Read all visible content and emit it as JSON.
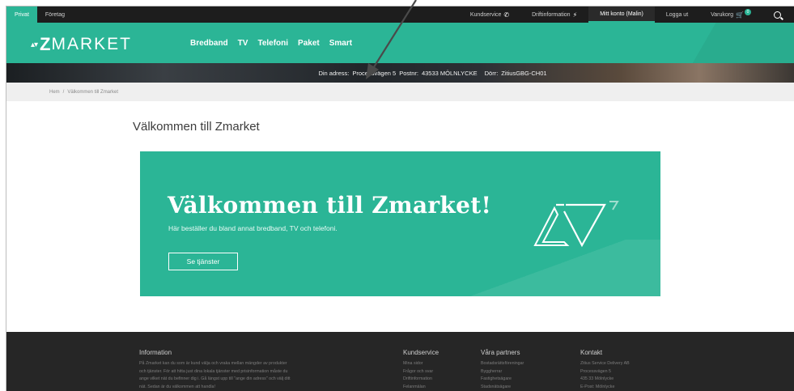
{
  "topbar": {
    "segments": [
      "Privat",
      "Företag"
    ],
    "links": [
      {
        "label": "Kundservice",
        "icon": "phone-icon"
      },
      {
        "label": "Driftinformation",
        "icon": "plug-icon"
      },
      {
        "label": "Mitt konto (Malin)",
        "icon": ""
      },
      {
        "label": "Logga ut",
        "icon": ""
      },
      {
        "label": "Varukorg",
        "icon": "cart-icon",
        "badge": "0"
      }
    ]
  },
  "header": {
    "logo_mark": "▴▾",
    "logo_z": "Z",
    "logo_rest": "MARKET",
    "nav": [
      "Bredband",
      "TV",
      "Telefoni",
      "Paket",
      "Smart"
    ]
  },
  "address": {
    "label": "Din adress:",
    "street": "Processvägen 5",
    "postnr_label": "Postnr:",
    "postnr": "43533 MÖLNLYCKE",
    "door_label": "Dörr:",
    "door": "ZitiusGBG-CH01"
  },
  "breadcrumb": {
    "home": "Hem",
    "sep": "/",
    "current": "Välkommen till Zmarket"
  },
  "main": {
    "page_title": "Välkommen till Zmarket",
    "hero_title": "Välkommen till Zmarket!",
    "hero_sub": "Här beställer du bland annat bredband, TV och telefoni.",
    "hero_button": "Se tjänster"
  },
  "footer": {
    "info_title": "Information",
    "info_lines": [
      "På Zmarket kan du som är kund välja och vraka mellan mängder av produkter",
      "och tjänster. För att hitta just dina lokala tjänster med prisinformation måste du",
      "ange vilket nät du befinner dig i. Gå längst upp till \"ange din adress\" och välj ditt",
      "nät. Sedan är du välkommen att handla!"
    ],
    "kundservice_title": "Kundservice",
    "kundservice_items": [
      "Mina sidor",
      "Frågor och svar",
      "Driftinformation",
      "Felanmälan"
    ],
    "partners_title": "Våra partners",
    "partners_items": [
      "Bostadsrättsföreningar",
      "Byggherrar",
      "Fastighetsägare",
      "Stadsnätsägare"
    ],
    "contact_title": "Kontakt",
    "contact_items": [
      "Zitius Service Delivery AB",
      "Processvägen 5",
      "435 33 Mölnlycke",
      "E-Post: Mölnlycke"
    ]
  },
  "colors": {
    "brand": "#2bb596",
    "topbar": "#1d1d1d",
    "footer": "#262626"
  }
}
